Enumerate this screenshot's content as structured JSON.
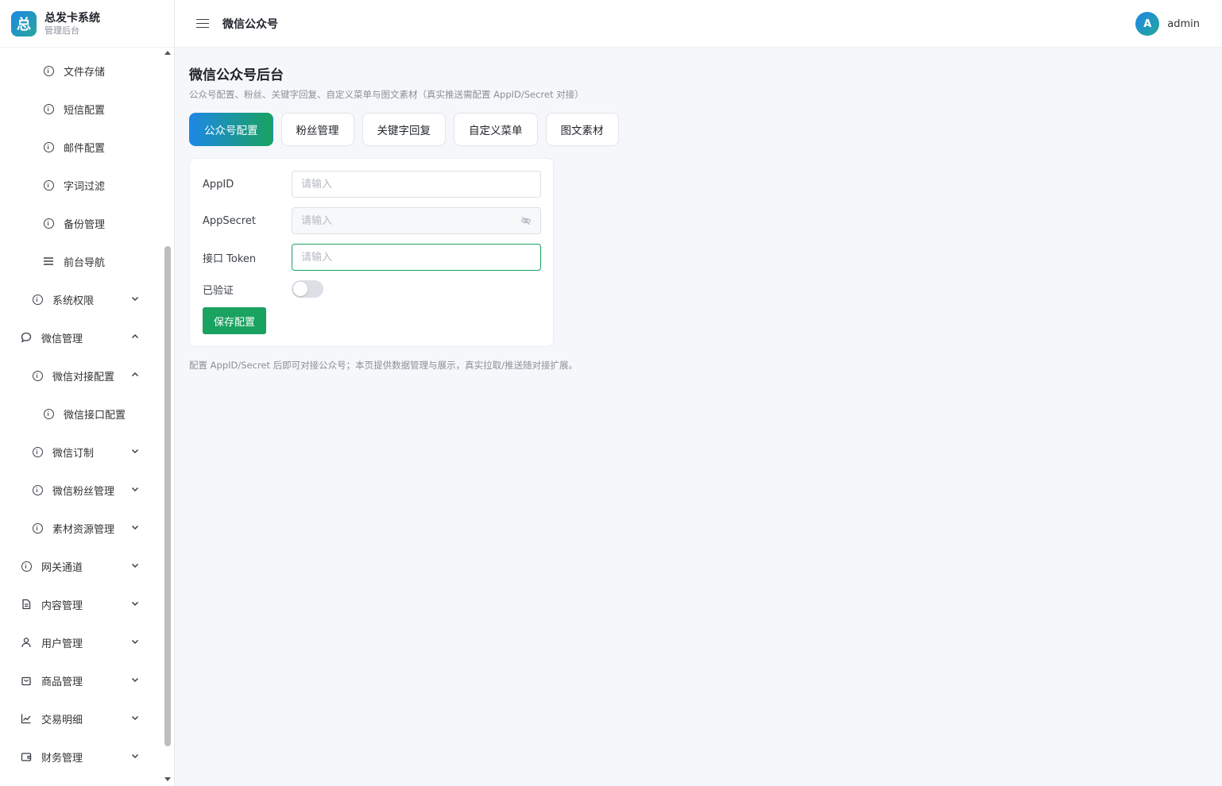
{
  "brand": {
    "logo_char": "总",
    "title": "总发卡系统",
    "subtitle": "管理后台"
  },
  "header": {
    "title": "微信公众号",
    "avatar_letter": "A",
    "user_name": "admin"
  },
  "sidebar": {
    "items": [
      {
        "label": "文件存储",
        "icon": "info-circle-icon",
        "level": 2
      },
      {
        "label": "短信配置",
        "icon": "info-circle-icon",
        "level": 2
      },
      {
        "label": "邮件配置",
        "icon": "info-circle-icon",
        "level": 2
      },
      {
        "label": "字词过滤",
        "icon": "info-circle-icon",
        "level": 2
      },
      {
        "label": "备份管理",
        "icon": "info-circle-icon",
        "level": 2
      },
      {
        "label": "前台导航",
        "icon": "menu-lines-icon",
        "level": 2
      },
      {
        "label": "系统权限",
        "icon": "info-circle-icon",
        "level": 1,
        "chevron": "down"
      },
      {
        "label": "微信管理",
        "icon": "chat-bubble-icon",
        "level": 0,
        "chevron": "up"
      },
      {
        "label": "微信对接配置",
        "icon": "info-circle-icon",
        "level": 1,
        "chevron": "up"
      },
      {
        "label": "微信接口配置",
        "icon": "info-circle-icon",
        "level": 2
      },
      {
        "label": "微信订制",
        "icon": "info-circle-icon",
        "level": 1,
        "chevron": "down"
      },
      {
        "label": "微信粉丝管理",
        "icon": "info-circle-icon",
        "level": 1,
        "chevron": "down"
      },
      {
        "label": "素材资源管理",
        "icon": "info-circle-icon",
        "level": 1,
        "chevron": "down"
      },
      {
        "label": "网关通道",
        "icon": "info-circle-icon",
        "level": 0,
        "chevron": "down"
      },
      {
        "label": "内容管理",
        "icon": "document-icon",
        "level": 0,
        "chevron": "down"
      },
      {
        "label": "用户管理",
        "icon": "user-icon",
        "level": 0,
        "chevron": "down"
      },
      {
        "label": "商品管理",
        "icon": "shopping-bag-icon",
        "level": 0,
        "chevron": "down"
      },
      {
        "label": "交易明细",
        "icon": "line-chart-icon",
        "level": 0,
        "chevron": "down"
      },
      {
        "label": "财务管理",
        "icon": "wallet-icon",
        "level": 0,
        "chevron": "down"
      }
    ]
  },
  "main": {
    "title": "微信公众号后台",
    "description": "公众号配置、粉丝、关键字回复、自定义菜单与图文素材（真实推送需配置 AppID/Secret 对接）",
    "tabs": [
      {
        "label": "公众号配置",
        "active": true
      },
      {
        "label": "粉丝管理",
        "active": false
      },
      {
        "label": "关键字回复",
        "active": false
      },
      {
        "label": "自定义菜单",
        "active": false
      },
      {
        "label": "图文素材",
        "active": false
      }
    ],
    "form": {
      "appid_label": "AppID",
      "appid_placeholder": "请输入",
      "appid_value": "",
      "secret_label": "AppSecret",
      "secret_placeholder": "请输入",
      "secret_value": "",
      "token_label": "接口 Token",
      "token_placeholder": "请输入",
      "token_value": "",
      "verified_label": "已验证",
      "verified": false,
      "save_label": "保存配置"
    },
    "footnote": "配置 AppID/Secret 后即可对接公众号；本页提供数据管理与展示，真实拉取/推送随对接扩展。"
  },
  "colors": {
    "accent": "#1aa260",
    "accent_blue": "#1e88e5"
  }
}
